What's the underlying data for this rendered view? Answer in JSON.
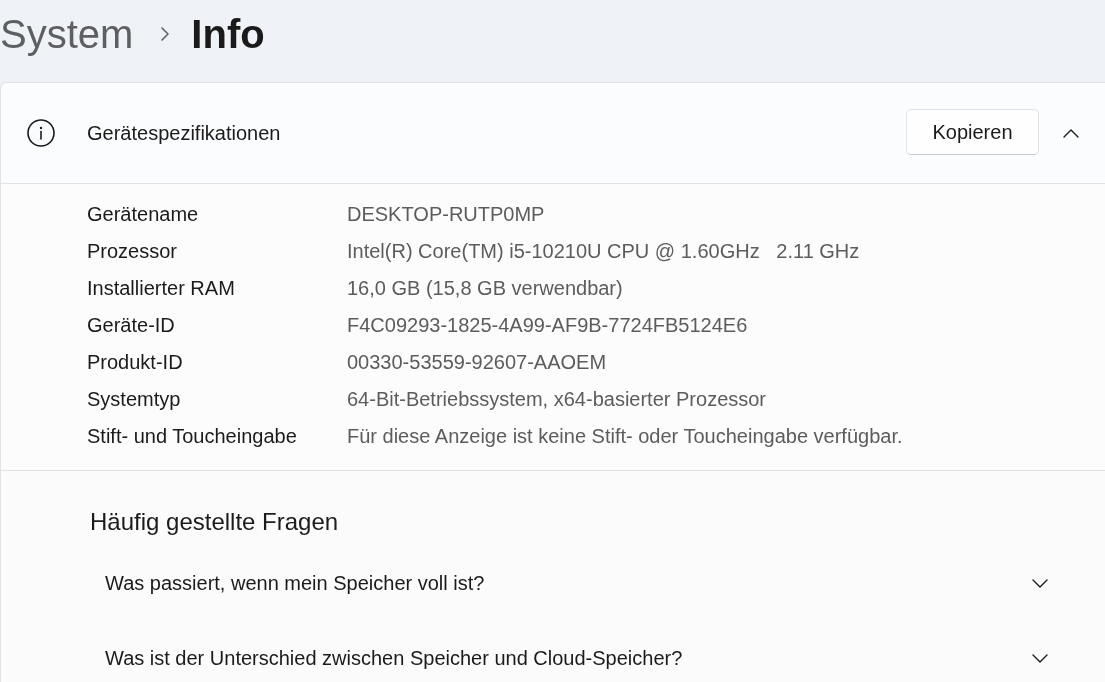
{
  "breadcrumb": [
    {
      "label": "System",
      "current": false
    },
    {
      "label": "Info",
      "current": true
    }
  ],
  "device_specs": {
    "title": "Gerätespezifikationen",
    "copy_button": "Kopieren",
    "expanded": true,
    "rows": [
      {
        "label": "Gerätename",
        "value": "DESKTOP-RUTP0MP"
      },
      {
        "label": "Prozessor",
        "value": "Intel(R) Core(TM) i5-10210U CPU @ 1.60GHz   2.11 GHz"
      },
      {
        "label": "Installierter RAM",
        "value": "16,0 GB (15,8 GB verwendbar)"
      },
      {
        "label": "Geräte-ID",
        "value": "F4C09293-1825-4A99-AF9B-7724FB5124E6"
      },
      {
        "label": "Produkt-ID",
        "value": "00330-53559-92607-AAOEM"
      },
      {
        "label": "Systemtyp",
        "value": "64-Bit-Betriebssystem, x64-basierter Prozessor"
      },
      {
        "label": "Stift- und Toucheingabe",
        "value": "Für diese Anzeige ist keine Stift- oder Toucheingabe verfügbar."
      }
    ]
  },
  "faq": {
    "title": "Häufig gestellte Fragen",
    "items": [
      {
        "question": "Was passiert, wenn mein Speicher voll ist?",
        "expanded": false
      },
      {
        "question": "Was ist der Unterschied zwischen Speicher und Cloud-Speicher?",
        "expanded": false
      }
    ]
  }
}
